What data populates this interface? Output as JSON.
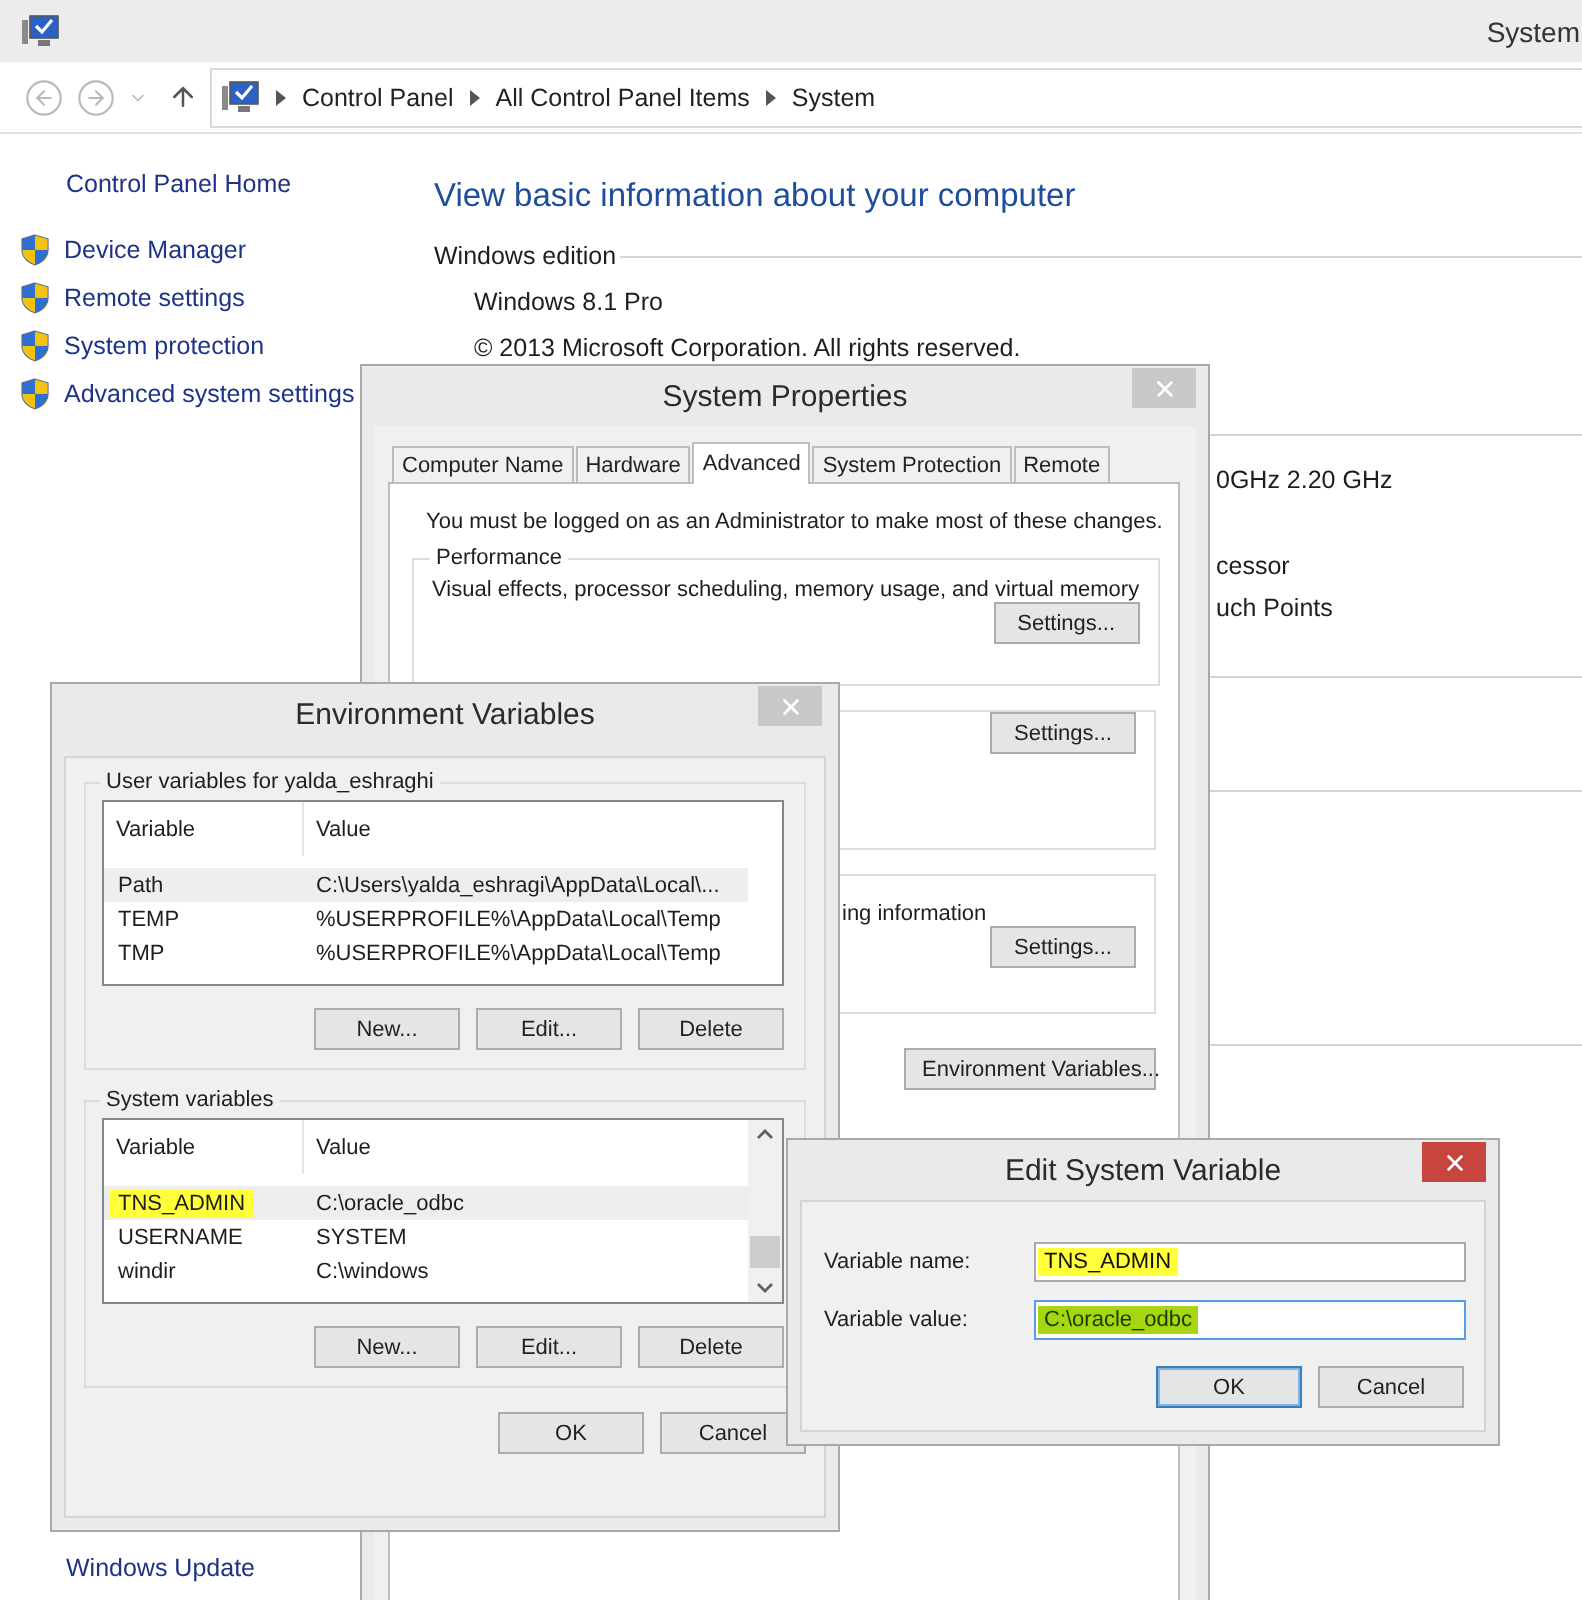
{
  "main_window": {
    "title": "System",
    "breadcrumb": [
      "Control Panel",
      "All Control Panel Items",
      "System"
    ],
    "sidebar": {
      "home": "Control Panel Home",
      "items": [
        "Device Manager",
        "Remote settings",
        "System protection",
        "Advanced system settings"
      ],
      "footer": "Windows Update"
    },
    "heading": "View basic information about your computer",
    "edition_section": "Windows edition",
    "edition_lines": [
      "Windows 8.1 Pro",
      "© 2013 Microsoft Corporation. All rights reserved."
    ],
    "partial_lines": [
      "0GHz  2.20 GHz",
      "cessor",
      "uch Points"
    ]
  },
  "system_properties": {
    "title": "System Properties",
    "tabs": [
      {
        "label": "Computer Name",
        "selected": false
      },
      {
        "label": "Hardware",
        "selected": false
      },
      {
        "label": "Advanced",
        "selected": true
      },
      {
        "label": "System Protection",
        "selected": false
      },
      {
        "label": "Remote",
        "selected": false
      }
    ],
    "note": "You must be logged on as an Administrator to make most of these changes.",
    "groups": [
      {
        "title": "Performance",
        "text": "Visual effects, processor scheduling, memory usage, and virtual memory",
        "button": "Settings..."
      },
      {
        "button": "Settings..."
      },
      {
        "text": "ing information",
        "button": "Settings..."
      }
    ],
    "env_button": "Environment Variables..."
  },
  "environment_variables": {
    "title": "Environment Variables",
    "sections": [
      {
        "title": "User variables for yalda_eshraghi",
        "columns": [
          "Variable",
          "Value"
        ],
        "scrollbar": false,
        "rows": [
          {
            "variable": "Path",
            "value": "C:\\Users\\yalda_eshragi\\AppData\\Local\\...",
            "selected": true,
            "highlighted": false
          },
          {
            "variable": "TEMP",
            "value": "%USERPROFILE%\\AppData\\Local\\Temp",
            "selected": false,
            "highlighted": false
          },
          {
            "variable": "TMP",
            "value": "%USERPROFILE%\\AppData\\Local\\Temp",
            "selected": false,
            "highlighted": false
          }
        ],
        "buttons": [
          "New...",
          "Edit...",
          "Delete"
        ]
      },
      {
        "title": "System variables",
        "columns": [
          "Variable",
          "Value"
        ],
        "scrollbar": true,
        "rows": [
          {
            "variable": "TNS_ADMIN",
            "value": "C:\\oracle_odbc",
            "selected": true,
            "highlighted": true
          },
          {
            "variable": "USERNAME",
            "value": "SYSTEM",
            "selected": false,
            "highlighted": false
          },
          {
            "variable": "windir",
            "value": "C:\\windows",
            "selected": false,
            "highlighted": false
          }
        ],
        "buttons": [
          "New...",
          "Edit...",
          "Delete"
        ]
      }
    ],
    "buttons": [
      "OK",
      "Cancel"
    ]
  },
  "edit_system_variable": {
    "title": "Edit System Variable",
    "fields": [
      {
        "label": "Variable name:",
        "value": "TNS_ADMIN",
        "highlighted": true,
        "focused": false
      },
      {
        "label": "Variable value:",
        "value": "C:\\oracle_odbc",
        "highlighted": true,
        "focused": true
      }
    ],
    "buttons": [
      {
        "label": "OK",
        "default": true
      },
      {
        "label": "Cancel",
        "default": false
      }
    ]
  }
}
